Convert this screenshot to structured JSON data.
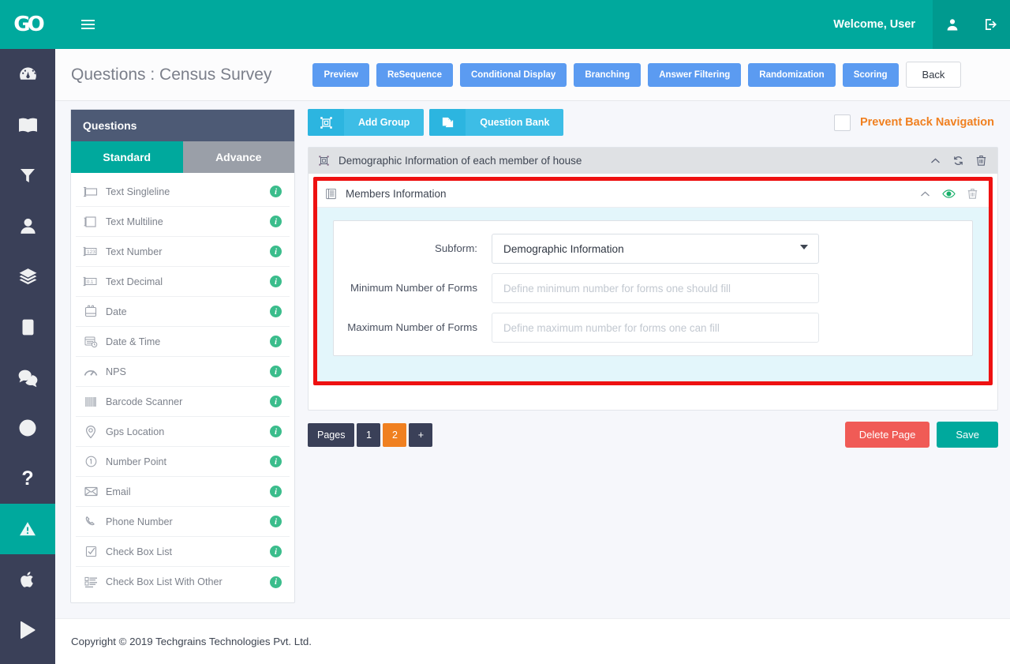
{
  "topbar": {
    "logo": "GO",
    "menu_icon": "hamburger-icon",
    "welcome": "Welcome, User",
    "user_icon": "user-icon",
    "logout_icon": "logout-icon"
  },
  "rail": {
    "items": [
      {
        "icon": "dashboard-icon",
        "active": false
      },
      {
        "icon": "book-icon",
        "active": false
      },
      {
        "icon": "filter-icon",
        "active": false
      },
      {
        "icon": "user-icon",
        "active": false
      },
      {
        "icon": "layers-icon",
        "active": false
      },
      {
        "icon": "tablet-icon",
        "active": false
      },
      {
        "icon": "chat-icon",
        "active": false
      },
      {
        "icon": "lifebuoy-icon",
        "active": false
      },
      {
        "icon": "question-mark-icon",
        "active": false
      },
      {
        "icon": "warning-triangle-icon",
        "active": true
      },
      {
        "icon": "apple-icon",
        "active": false
      },
      {
        "icon": "play-store-icon",
        "active": false
      }
    ]
  },
  "page": {
    "title": "Questions : Census Survey",
    "buttons": [
      {
        "label": "Preview",
        "style": "primary"
      },
      {
        "label": "ReSequence",
        "style": "primary"
      },
      {
        "label": "Conditional Display",
        "style": "primary"
      },
      {
        "label": "Branching",
        "style": "primary"
      },
      {
        "label": "Answer Filtering",
        "style": "primary"
      },
      {
        "label": "Randomization",
        "style": "primary"
      },
      {
        "label": "Scoring",
        "style": "primary"
      },
      {
        "label": "Back",
        "style": "back"
      }
    ]
  },
  "questions_panel": {
    "heading": "Questions",
    "tabs": [
      {
        "label": "Standard",
        "selected": true
      },
      {
        "label": "Advance",
        "selected": false
      }
    ],
    "items": [
      {
        "label": "Text Singleline",
        "icon": "text-singleline-icon",
        "info": "i"
      },
      {
        "label": "Text Multiline",
        "icon": "text-multiline-icon",
        "info": "i"
      },
      {
        "label": "Text Number",
        "icon": "text-number-icon",
        "info": "i"
      },
      {
        "label": "Text Decimal",
        "icon": "text-decimal-icon",
        "info": "i"
      },
      {
        "label": "Date",
        "icon": "calendar-icon",
        "info": "i"
      },
      {
        "label": "Date & Time",
        "icon": "calendar-clock-icon",
        "info": "i"
      },
      {
        "label": "NPS",
        "icon": "gauge-icon",
        "info": "i"
      },
      {
        "label": "Barcode Scanner",
        "icon": "barcode-icon",
        "info": "i"
      },
      {
        "label": "Gps Location",
        "icon": "map-pin-icon",
        "info": "i"
      },
      {
        "label": "Number Point",
        "icon": "number-point-icon",
        "info": "i"
      },
      {
        "label": "Email",
        "icon": "envelope-icon",
        "info": "i"
      },
      {
        "label": "Phone Number",
        "icon": "phone-icon",
        "info": "i"
      },
      {
        "label": "Check Box List",
        "icon": "checkbox-icon",
        "info": "i"
      },
      {
        "label": "Check Box List With Other",
        "icon": "checkbox-list-other-icon",
        "info": "i"
      }
    ]
  },
  "toolbar": {
    "add_group_label": "Add Group",
    "add_group_icon": "group-frame-icon",
    "question_bank_label": "Question Bank",
    "question_bank_icon": "copy-pages-icon",
    "prevent_back_label": "Prevent Back Navigation",
    "prevent_back_checked": false
  },
  "group": {
    "title": "Demographic Information of each member of house",
    "icon": "group-frame-icon",
    "actions": [
      {
        "name": "collapse-chevron-icon"
      },
      {
        "name": "refresh-icon"
      },
      {
        "name": "trash-icon"
      }
    ]
  },
  "subform_block": {
    "title": "Members Information",
    "icon": "subform-icon",
    "actions": [
      {
        "name": "collapse-chevron-icon"
      },
      {
        "name": "eye-icon"
      },
      {
        "name": "trash-icon"
      }
    ],
    "fields": [
      {
        "label": "Subform:",
        "type": "select",
        "value": "Demographic Information",
        "placeholder": ""
      },
      {
        "label": "Minimum Number of Forms",
        "type": "input",
        "value": "",
        "placeholder": "Define minimum number for forms one should fill"
      },
      {
        "label": "Maximum Number of Forms",
        "type": "input",
        "value": "",
        "placeholder": "Define maximum number for forms one can fill"
      }
    ]
  },
  "pager": {
    "label": "Pages",
    "pages": [
      {
        "label": "1",
        "active": false
      },
      {
        "label": "2",
        "active": true
      }
    ],
    "add_label": "+"
  },
  "actions": {
    "delete_page_label": "Delete Page",
    "save_label": "Save"
  },
  "footer": {
    "copyright": "Copyright © 2019 Techgrains Technologies Pvt. Ltd."
  },
  "colors": {
    "brand_teal": "#00a99d",
    "rail_dark": "#3a4058",
    "primary_blue": "#5b9bf1",
    "toolbar_cyan": "#3dbde6",
    "accent_orange": "#f08020",
    "highlight_red": "#ee1111",
    "subform_bg": "#e3f6fb",
    "danger_red": "#f05b56",
    "info_green": "#3bbd8c"
  }
}
